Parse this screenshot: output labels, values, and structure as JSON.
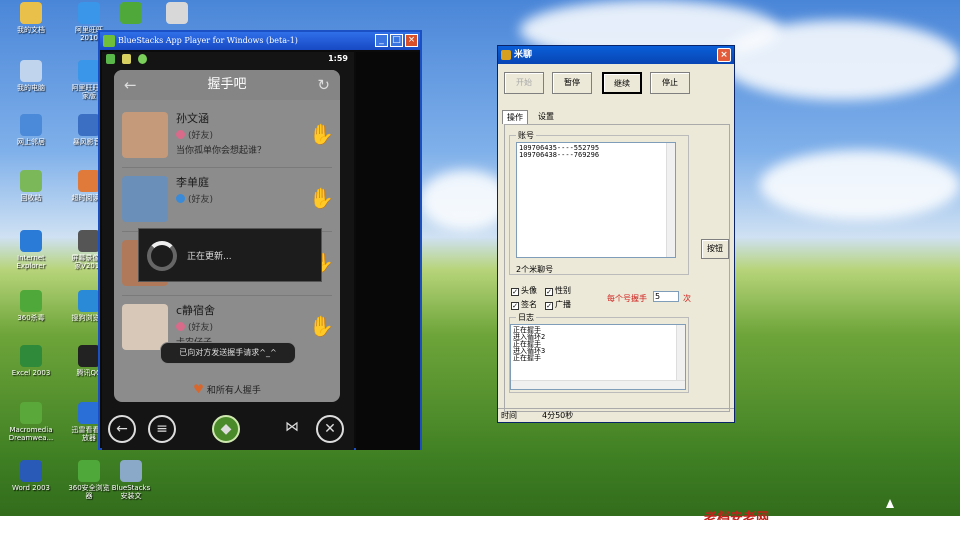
{
  "desktop": {
    "icons": [
      {
        "label": "我的文档",
        "icon": "folder-docs-icon",
        "color": "#e8c04a"
      },
      {
        "label": "阿里旺旺\n2010",
        "icon": "aliwangwang-icon",
        "color": "#3a96e8"
      },
      {
        "label": "",
        "icon": "plus-app-icon",
        "color": "#4fa83a"
      },
      {
        "label": "",
        "icon": "av-file-icon",
        "color": "#d8d8d8"
      },
      {
        "label": "我的电脑",
        "icon": "computer-icon",
        "color": "#c0d4ee"
      },
      {
        "label": "阿里旺旺卖\n家版",
        "icon": "aliwangwang-seller-icon",
        "color": "#3a96e8"
      },
      {
        "label": "网上邻居",
        "icon": "network-icon",
        "color": "#4a8ad8"
      },
      {
        "label": "暴风影音5",
        "icon": "baofeng-icon",
        "color": "#3a6fc4"
      },
      {
        "label": "回收站",
        "icon": "recycle-bin-icon",
        "color": "#7ab85a"
      },
      {
        "label": "超时阅读器",
        "icon": "reader-icon",
        "color": "#e07a3a"
      },
      {
        "label": "Internet\nExplorer",
        "icon": "ie-icon",
        "color": "#2a7ad8"
      },
      {
        "label": "屏幕录像专\n家V2012",
        "icon": "screen-recorder-icon",
        "color": "#555555"
      },
      {
        "label": "360杀毒",
        "icon": "shield-360-icon",
        "color": "#4fa83a"
      },
      {
        "label": "搜狗浏览器",
        "icon": "sogou-icon",
        "color": "#2a8ad8"
      },
      {
        "label": "Excel 2003",
        "icon": "excel-icon",
        "color": "#2f8a3a"
      },
      {
        "label": "腾讯QQ",
        "icon": "qq-icon",
        "color": "#222222"
      },
      {
        "label": "Macromedia\nDreamwea...",
        "icon": "dreamweaver-icon",
        "color": "#5aa83a"
      },
      {
        "label": "迅雷看看播\n放器",
        "icon": "xunlei-icon",
        "color": "#2a6fd8"
      },
      {
        "label": "Word 2003",
        "icon": "word-icon",
        "color": "#2a5ab8"
      },
      {
        "label": "360安全浏览\n器",
        "icon": "browser-360-icon",
        "color": "#4fa83a"
      },
      {
        "label": "BlueStacks\n安装文",
        "icon": "bluestacks-setup-icon",
        "color": "#8aa8c8"
      }
    ],
    "bottom_red_text": "老档安老网"
  },
  "bluestacks": {
    "title": "BlueStacks App Player for Windows (beta-1)",
    "time": "1:59",
    "app_title": "握手吧",
    "contacts": [
      {
        "name": "孙文涵",
        "relation": "(好友)",
        "message": "当你孤单你会想起谁？",
        "avatar_color": "#c49a7a"
      },
      {
        "name": "李单庭",
        "relation": "(好友)",
        "message": "",
        "avatar_color": "#6a8fb8"
      },
      {
        "name": "",
        "relation": "",
        "message": "",
        "avatar_color": "#b07a5a"
      },
      {
        "name": "c静宿舍",
        "relation": "(好友)",
        "message": "卡农仔子",
        "avatar_color": "#d8c8b8"
      }
    ],
    "footer_action": "和所有人握手",
    "loading_text": "正在更新...",
    "toast_text": "已向对方发送握手请求^_^"
  },
  "miliao": {
    "title": "米聊",
    "buttons": {
      "start": "开始",
      "pause": "暂停",
      "resume": "继续",
      "stop": "停止"
    },
    "tabs": {
      "operation": "操作",
      "settings": "设置"
    },
    "accounts_label": "账号",
    "accounts": [
      "109706435----552795",
      "109706438----769296"
    ],
    "account_count": "2个米聊号",
    "side_button": "按钮",
    "options": {
      "avatar": "头像",
      "gender": "性别",
      "signature": "签名",
      "broadcast": "广播",
      "per_number_label": "每个号握手",
      "per_number_value": "5",
      "per_number_unit": "次"
    },
    "log_label": "日志",
    "log_lines": [
      "正在握手",
      "进入循环2",
      "正在握手",
      "进入循环3",
      "正在握手"
    ],
    "status": {
      "time_label": "时间",
      "time_value": "4分50秒"
    }
  }
}
